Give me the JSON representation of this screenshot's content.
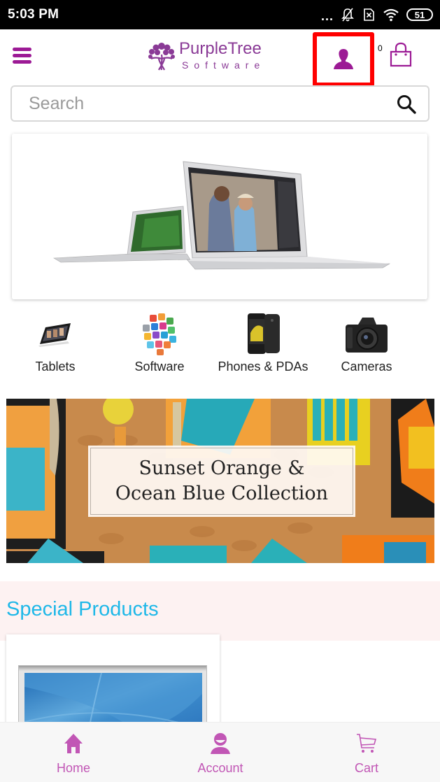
{
  "status_bar": {
    "time": "5:03 PM",
    "overflow_dots": "...",
    "battery": "51",
    "icons": [
      "notifications-off-icon",
      "sim-x-icon",
      "wifi-icon",
      "battery-icon"
    ]
  },
  "header": {
    "menu_icon": "hamburger-icon",
    "logo": {
      "line1": "PurpleTree",
      "line2": "Software"
    },
    "account_icon": "user-icon",
    "cart_count": "0",
    "cart_icon": "shopping-bag-icon"
  },
  "search": {
    "placeholder": "Search",
    "value": "",
    "icon": "search-icon"
  },
  "hero_banner": {
    "alt": "MacBook Air laptops"
  },
  "categories": [
    {
      "label": "Tablets",
      "icon": "tablet-icon"
    },
    {
      "label": "Software",
      "icon": "software-icon"
    },
    {
      "label": "Phones & PDAs",
      "icon": "phone-icon"
    },
    {
      "label": "Cameras",
      "icon": "camera-icon"
    }
  ],
  "collection_banner": {
    "line1": "Sunset Orange &",
    "line2": "Ocean Blue Collection"
  },
  "special_products": {
    "title": "Special Products"
  },
  "bottom_nav": [
    {
      "label": "Home",
      "icon": "home-icon"
    },
    {
      "label": "Account",
      "icon": "account-icon"
    },
    {
      "label": "Cart",
      "icon": "cart-icon"
    }
  ],
  "colors": {
    "brand_purple": "#9c1a95",
    "nav_pink": "#c156b5",
    "accent_cyan": "#1fb8e8",
    "highlight_red": "#ff0000",
    "special_bg": "#fdf2f2"
  }
}
